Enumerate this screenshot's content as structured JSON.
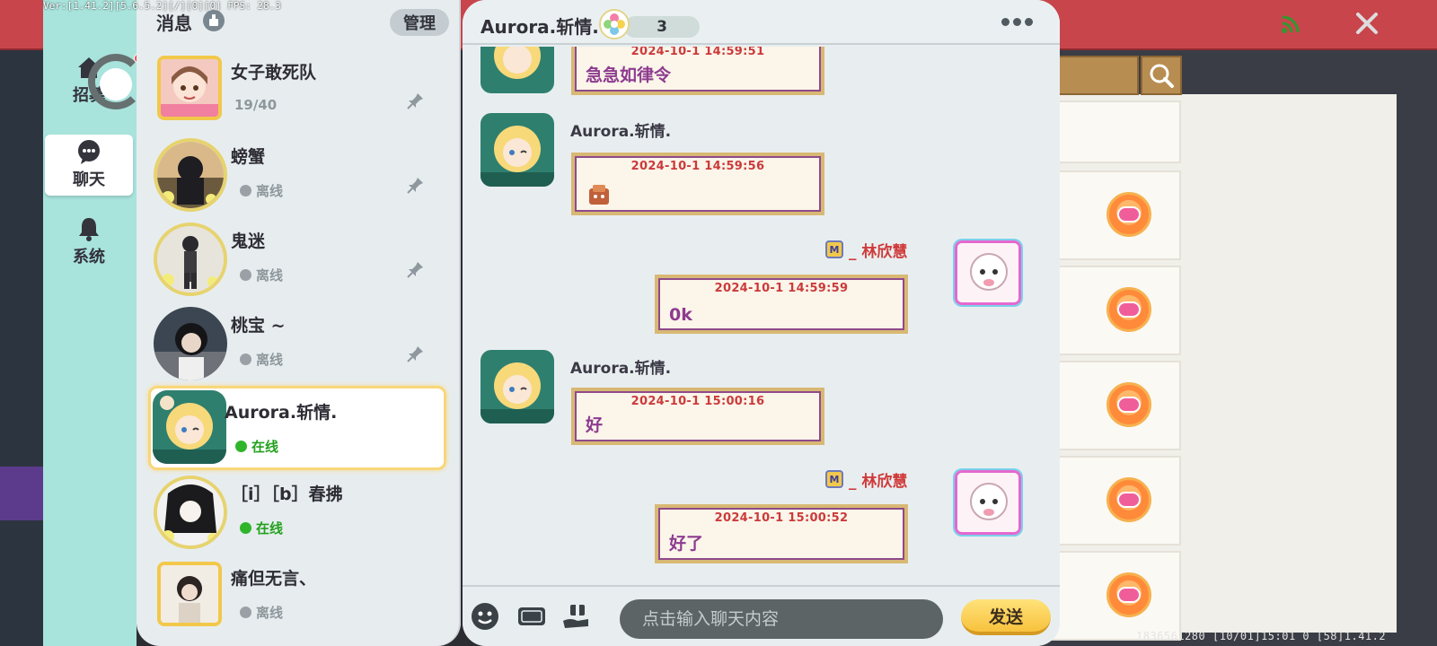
{
  "debug": {
    "version_text": "Ver:[1.41.2][5.6.5.2][",
    "fps_text": "/][0][0] FPS: 28.3"
  },
  "footer": {
    "id_text": "1836561280   [10/01]15:01 0   [58]1.41.2"
  },
  "nav": {
    "items": [
      {
        "label": "招募",
        "icon": "recruit-icon"
      },
      {
        "label": "聊天",
        "icon": "chat-icon"
      },
      {
        "label": "系统",
        "icon": "bell-icon"
      }
    ]
  },
  "list": {
    "title": "消息",
    "manage_label": "管理",
    "contacts": [
      {
        "name": "女子敢死队",
        "status": "19/40",
        "pinned": true,
        "online": false
      },
      {
        "name": "螃蟹",
        "status": "离线",
        "pinned": true,
        "online": false
      },
      {
        "name": "鬼迷",
        "status": "离线",
        "pinned": true,
        "online": false
      },
      {
        "name": "桃宝 ~",
        "status": "离线",
        "pinned": true,
        "online": false
      },
      {
        "name": "Aurora.斩情.",
        "status": "在线",
        "pinned": false,
        "online": true,
        "selected": true
      },
      {
        "name": "［i］［b］春拂",
        "status": "在线",
        "pinned": false,
        "online": true
      },
      {
        "name": "痛但无言、",
        "status": "离线",
        "pinned": false,
        "online": false
      }
    ]
  },
  "chat": {
    "title": "Aurora.斩情.",
    "flower_count": "3",
    "messages": [
      {
        "sender": "",
        "time": "2024-10-1     14:59:51",
        "text": "急急如律令",
        "self": false
      },
      {
        "sender": "Aurora.斩情.",
        "time": "2024-10-1     14:59:56",
        "text": "",
        "self": false
      },
      {
        "sender": "_ 林欣慧",
        "time": "2024-10-1     14:59:59",
        "text": "0k",
        "self": true
      },
      {
        "sender": "Aurora.斩情.",
        "time": "2024-10-1     15:00:16",
        "text": "好",
        "self": false
      },
      {
        "sender": "_ 林欣慧",
        "time": "2024-10-1     15:00:52",
        "text": "好了",
        "self": true
      }
    ],
    "input_placeholder": "点击输入聊天内容",
    "send_label": "发送"
  },
  "colors": {
    "nav_bg": "#a8e3dc",
    "panel_bg": "#e7edef",
    "time_red": "#cc3a3a",
    "message_purple": "#8d3b8f",
    "online_green": "#23a11d",
    "send_yellow": "#f7c23d"
  }
}
